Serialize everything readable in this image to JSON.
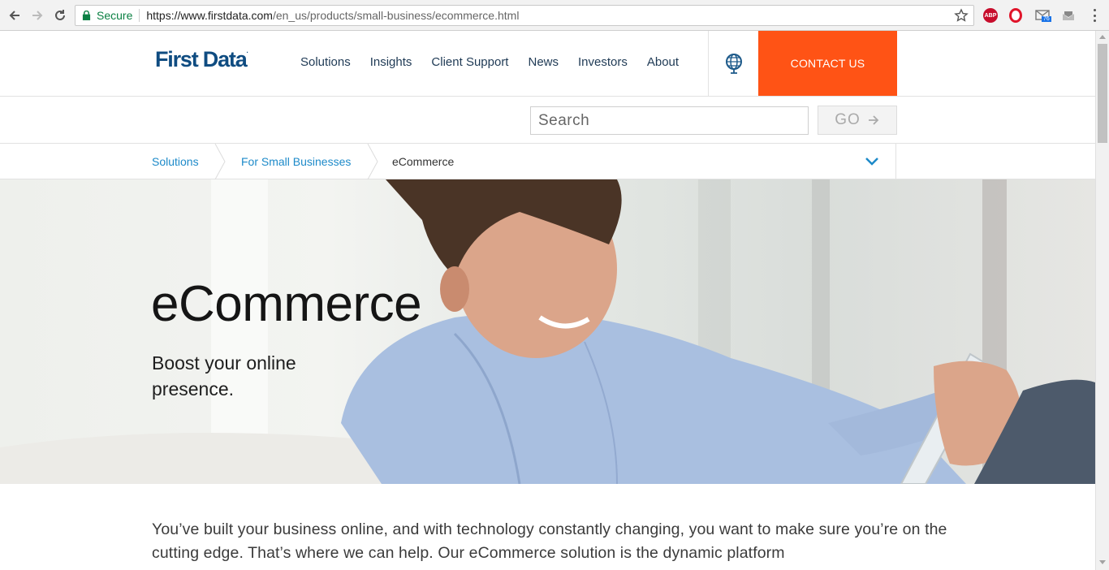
{
  "browser": {
    "secure_label": "Secure",
    "url_host": "https://www.firstdata.com",
    "url_path": "/en_us/products/small-business/ecommerce.html",
    "extensions": [
      {
        "name": "adblock-plus",
        "label": "ABP",
        "color": "#c70d2c"
      },
      {
        "name": "opera",
        "label": "O",
        "color": "#e0142a"
      },
      {
        "name": "mail-checker",
        "badge": "76",
        "color": "#1a73e8"
      },
      {
        "name": "inbox",
        "color": "#888888"
      }
    ]
  },
  "site": {
    "logo": "First Data",
    "logo_mark": ".",
    "nav": [
      "Solutions",
      "Insights",
      "Client Support",
      "News",
      "Investors",
      "About"
    ],
    "contact_label": "CONTACT US",
    "accent_color": "#ff5315",
    "brand_color": "#0f4c81"
  },
  "search": {
    "placeholder": "Search",
    "go_label": "GO"
  },
  "breadcrumb": {
    "items": [
      "Solutions",
      "For Small Businesses"
    ],
    "current": "eCommerce"
  },
  "hero": {
    "title": "eCommerce",
    "subtitle": "Boost your online presence."
  },
  "intro": {
    "text": "You’ve built your business online, and with technology constantly changing, you want to make sure you’re on the cutting edge. That’s where we can help. Our eCommerce solution is the dynamic platform"
  }
}
